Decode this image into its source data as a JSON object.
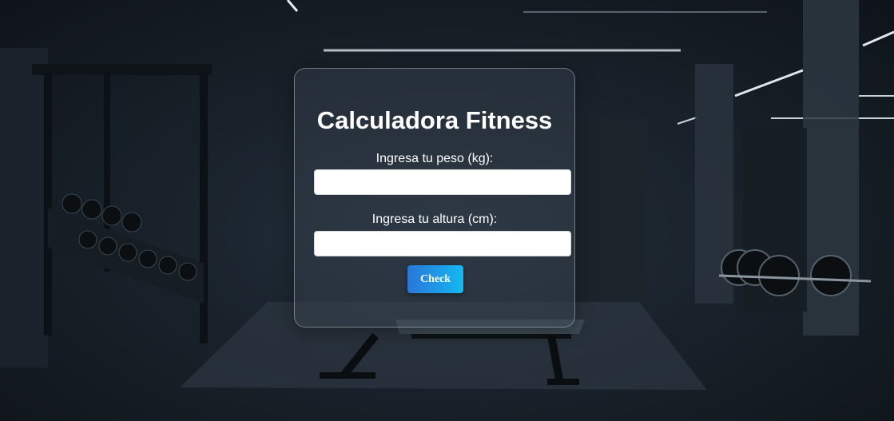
{
  "calculator": {
    "title": "Calculadora Fitness",
    "weight_label": "Ingresa tu peso (kg):",
    "weight_value": "",
    "height_label": "Ingresa tu altura (cm):",
    "height_value": "",
    "check_button": "Check"
  },
  "colors": {
    "button_gradient_start": "#2a76d9",
    "button_gradient_end": "#14b8f2",
    "background": "#121a22"
  }
}
